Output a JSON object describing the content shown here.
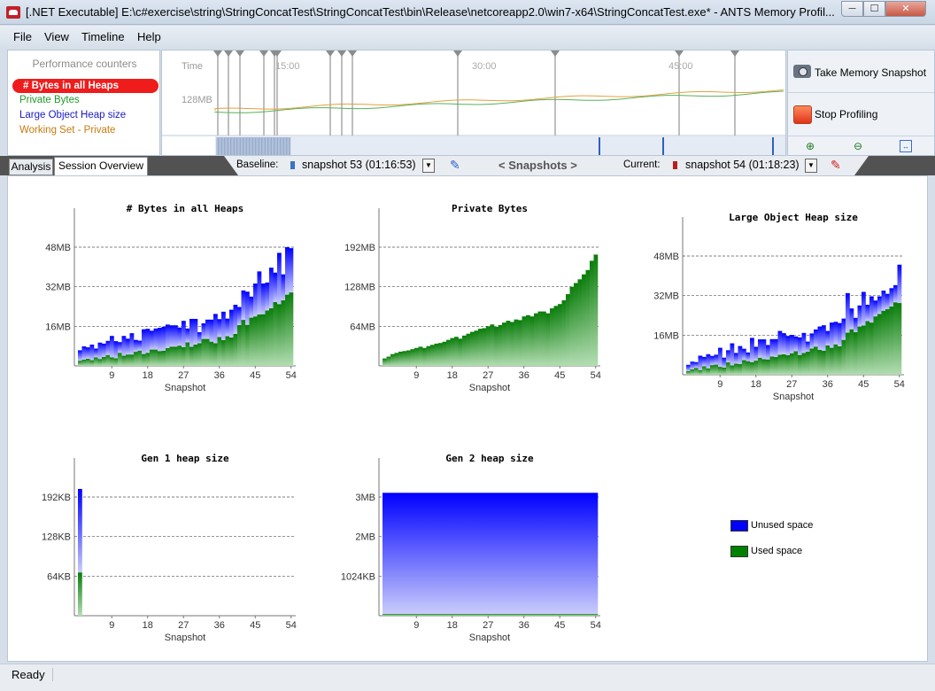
{
  "window": {
    "title": "[.NET Executable] E:\\c#exercise\\string\\StringConcatTest\\StringConcatTest\\bin\\Release\\netcoreapp2.0\\win7-x64\\StringConcatTest.exe* - ANTS Memory Profil...",
    "min": "─",
    "max": "☐",
    "close": "✕"
  },
  "menu": {
    "file": "File",
    "view": "View",
    "timeline": "Timeline",
    "help": "Help"
  },
  "counters": {
    "title": "Performance counters",
    "items": [
      "# Bytes in all Heaps",
      "Private Bytes",
      "Large Object Heap size",
      "Working Set - Private"
    ]
  },
  "timeline": {
    "time_label": "Time",
    "y_label": "128MB",
    "ticks": [
      "15:00",
      "30:00",
      "45:00"
    ]
  },
  "actions": {
    "snapshot": "Take Memory Snapshot",
    "stop": "Stop Profiling"
  },
  "tabs": {
    "analysis": "Analysis",
    "overview": "Session Overview"
  },
  "snapbar": {
    "baseline_label": "Baseline:",
    "baseline_value": "snapshot 53 (01:16:53)",
    "nav": "< Snapshots >",
    "current_label": "Current:",
    "current_value": "snapshot 54 (01:18:23)"
  },
  "legend": {
    "unused": "Unused space",
    "used": "Used space"
  },
  "colors": {
    "unused": "#0000ff",
    "used": "#008000",
    "highlight": "#ef1c1c"
  },
  "status": "Ready",
  "chart_data": [
    {
      "type": "bar",
      "title": "# Bytes in all Heaps",
      "xlabel": "Snapshot",
      "xticks": [
        9,
        18,
        27,
        36,
        45,
        54
      ],
      "yticks": [
        "16MB",
        "32MB",
        "48MB"
      ],
      "ylim": [
        0,
        48
      ],
      "unit": "MB",
      "series": [
        {
          "name": "Used space",
          "values": [
            2.1,
            2.5,
            2.9,
            2.3,
            3.5,
            2.8,
            3.6,
            4.4,
            3.5,
            3.1,
            5.3,
            4.1,
            4.6,
            4.6,
            5.7,
            6.2,
            4.8,
            5.3,
            6.6,
            6.6,
            6.0,
            6.1,
            7.2,
            7.8,
            7.8,
            8.2,
            7.6,
            9.5,
            7.7,
            8.6,
            9.2,
            10.9,
            10.9,
            9.8,
            9.2,
            11.7,
            10.4,
            12.0,
            11.5,
            12.9,
            16.5,
            18.6,
            16.6,
            19.5,
            20.0,
            20.8,
            20.9,
            22.4,
            23.3,
            25.8,
            25.0,
            26.5,
            28.8,
            29.7
          ]
        },
        {
          "name": "Unused space",
          "values": [
            4.2,
            5.4,
            4.6,
            6.3,
            3.5,
            6.6,
            5.4,
            5.7,
            8.6,
            6.9,
            4.3,
            8.0,
            6.4,
            8.6,
            4.8,
            4.0,
            10.0,
            9.7,
            7.6,
            8.5,
            9.4,
            9.7,
            9.5,
            8.6,
            8.6,
            7.3,
            10.6,
            5.6,
            11.3,
            10.4,
            4.4,
            6.3,
            7.8,
            8.9,
            11.8,
            7.2,
            11.5,
            7.1,
            11.2,
            11.8,
            7.3,
            11.9,
            13.4,
            8.5,
            13.3,
            17.4,
            12.4,
            11.3,
            16.4,
            11.9,
            20.7,
            10.5,
            19.2,
            17.9
          ]
        }
      ]
    },
    {
      "type": "bar",
      "title": "Private Bytes",
      "xlabel": "Snapshot",
      "xticks": [
        9,
        18,
        27,
        36,
        45,
        54
      ],
      "yticks": [
        "64MB",
        "128MB",
        "192MB"
      ],
      "ylim": [
        0,
        192
      ],
      "unit": "MB",
      "series": [
        {
          "name": "Private Bytes",
          "values": [
            12,
            15,
            19,
            21,
            23,
            24,
            25,
            27,
            29,
            31,
            29,
            32,
            34,
            36,
            37,
            39,
            42,
            45,
            47,
            44,
            49,
            52,
            55,
            57,
            60,
            61,
            64,
            67,
            63,
            66,
            70,
            73,
            71,
            75,
            74,
            80,
            82,
            80,
            85,
            88,
            88,
            85,
            93,
            97,
            100,
            106,
            116,
            128,
            134,
            140,
            148,
            155,
            170,
            180
          ]
        }
      ]
    },
    {
      "type": "bar",
      "title": "Large Object Heap size",
      "xlabel": "Snapshot",
      "xticks": [
        9,
        18,
        27,
        36,
        45,
        54
      ],
      "yticks": [
        "16MB",
        "32MB",
        "48MB"
      ],
      "ylim": [
        0,
        48
      ],
      "unit": "MB",
      "series": [
        {
          "name": "Used space",
          "values": [
            1.5,
            2.2,
            2.8,
            1.9,
            3.4,
            2.6,
            3.9,
            4.1,
            3.2,
            2.9,
            5.0,
            3.8,
            4.5,
            4.3,
            5.9,
            5.5,
            5.1,
            5.7,
            6.9,
            6.3,
            6.2,
            7.4,
            7.2,
            8.1,
            8.3,
            7.9,
            8.7,
            9.5,
            8.0,
            8.8,
            9.3,
            10.6,
            11.4,
            10.1,
            9.7,
            11.9,
            10.9,
            12.3,
            11.5,
            14.1,
            17.0,
            18.4,
            17.2,
            19.5,
            19.9,
            21.7,
            21.1,
            23.6,
            24.6,
            25.9,
            26.5,
            27.6,
            29.3,
            29.0
          ]
        },
        {
          "name": "Unused space",
          "values": [
            2.5,
            3.1,
            2.3,
            5.8,
            3.8,
            5.7,
            3.7,
            4.0,
            7.7,
            4.0,
            4.9,
            8.9,
            4.3,
            7.3,
            4.6,
            3.5,
            9.8,
            5.6,
            7.4,
            8.0,
            5.8,
            7.0,
            7.2,
            9.6,
            8.5,
            7.8,
            7.4,
            6.0,
            7.1,
            8.1,
            4.1,
            6.1,
            6.9,
            9.4,
            10.3,
            5.8,
            10.2,
            9.1,
            9.4,
            8.6,
            16.0,
            8.4,
            5.8,
            8.5,
            13.6,
            6.6,
            10.6,
            6.4,
            7.1,
            8.1,
            6.2,
            7.4,
            6.9,
            15.5
          ]
        }
      ]
    },
    {
      "type": "bar",
      "title": "Gen 1 heap size",
      "xlabel": "Snapshot",
      "xticks": [
        9,
        18,
        27,
        36,
        45,
        54
      ],
      "yticks": [
        "64KB",
        "128KB",
        "192KB"
      ],
      "ylim": [
        0,
        192
      ],
      "unit": "KB",
      "series": [
        {
          "name": "Used space",
          "values": [
            70
          ]
        },
        {
          "name": "Unused space",
          "values": [
            135
          ]
        }
      ]
    },
    {
      "type": "bar",
      "title": "Gen 2 heap size",
      "xlabel": "Snapshot",
      "xticks": [
        9,
        18,
        27,
        36,
        45,
        54
      ],
      "yticks": [
        "1024KB",
        "2MB",
        "3MB"
      ],
      "ylim": [
        0,
        3072
      ],
      "unit": "KB",
      "series": [
        {
          "name": "Used space",
          "values": [
            45,
            45,
            45,
            45,
            45,
            45,
            45,
            45,
            45,
            45,
            45,
            45,
            45,
            45,
            45,
            45,
            45,
            45,
            45,
            45,
            45,
            45,
            45,
            45,
            45,
            45,
            45,
            45,
            45,
            45,
            45,
            45,
            45,
            45,
            45,
            45,
            45,
            45,
            45,
            45,
            45,
            45,
            45,
            45,
            45,
            45,
            45,
            45,
            45,
            45,
            45,
            45,
            45,
            45
          ]
        },
        {
          "name": "Unused space",
          "values": [
            3135,
            3135,
            3135,
            3135,
            3135,
            3135,
            3135,
            3135,
            3135,
            3135,
            3135,
            3135,
            3135,
            3135,
            3135,
            3135,
            3135,
            3135,
            3135,
            3135,
            3135,
            3135,
            3135,
            3135,
            3135,
            3135,
            3135,
            3135,
            3135,
            3135,
            3135,
            3135,
            3135,
            3135,
            3135,
            3135,
            3135,
            3135,
            3135,
            3135,
            3135,
            3135,
            3135,
            3135,
            3135,
            3135,
            3135,
            3135,
            3135,
            3135,
            3135,
            3135,
            3135,
            3135
          ]
        }
      ]
    }
  ]
}
